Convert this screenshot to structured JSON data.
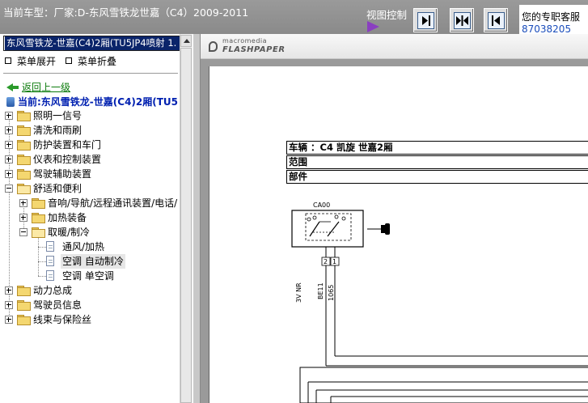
{
  "header": {
    "car_title": "当前车型：厂家:D-东风雪铁龙世嘉（C4）2009-2011",
    "view_control_label": "视图控制",
    "expert_name": "您的专职客服",
    "expert_phone": "87038205"
  },
  "tree": {
    "panel_title": "东风雪铁龙-世嘉(C4)2厢(TU5JP4喷射 1.",
    "menu_expand": "菜单展开",
    "menu_collapse": "菜单折叠",
    "back_label": "返回上一级",
    "current_label": "当前:东风雪铁龙-世嘉(C4)2厢(TU5",
    "items": [
      {
        "label": "照明一信号"
      },
      {
        "label": "清洗和雨刷"
      },
      {
        "label": "防护装置和车门"
      },
      {
        "label": "仪表和控制装置"
      },
      {
        "label": "驾驶辅助装置"
      },
      {
        "label": "舒适和便利"
      },
      {
        "label": "音响/导航/远程通讯装置/电话/"
      },
      {
        "label": "加热装备"
      },
      {
        "label": "取暖/制冷"
      },
      {
        "label": "通风/加热"
      },
      {
        "label": "空调 自动制冷"
      },
      {
        "label": "空调 单空调"
      },
      {
        "label": "动力总成"
      },
      {
        "label": "驾驶员信息"
      },
      {
        "label": "线束与保险丝"
      }
    ]
  },
  "viewer": {
    "logo_top": "macromedia",
    "logo_bottom": "FLASHPAPER",
    "doc_rows": [
      "车辆 ：C4 凯旋 世嘉2厢",
      "范围",
      "部件"
    ],
    "component_code": "CA00",
    "wire_labels": {
      "left": "3V NR",
      "mid": "BE11",
      "right": "1065",
      "pin2": "2",
      "pin1": "1"
    }
  }
}
